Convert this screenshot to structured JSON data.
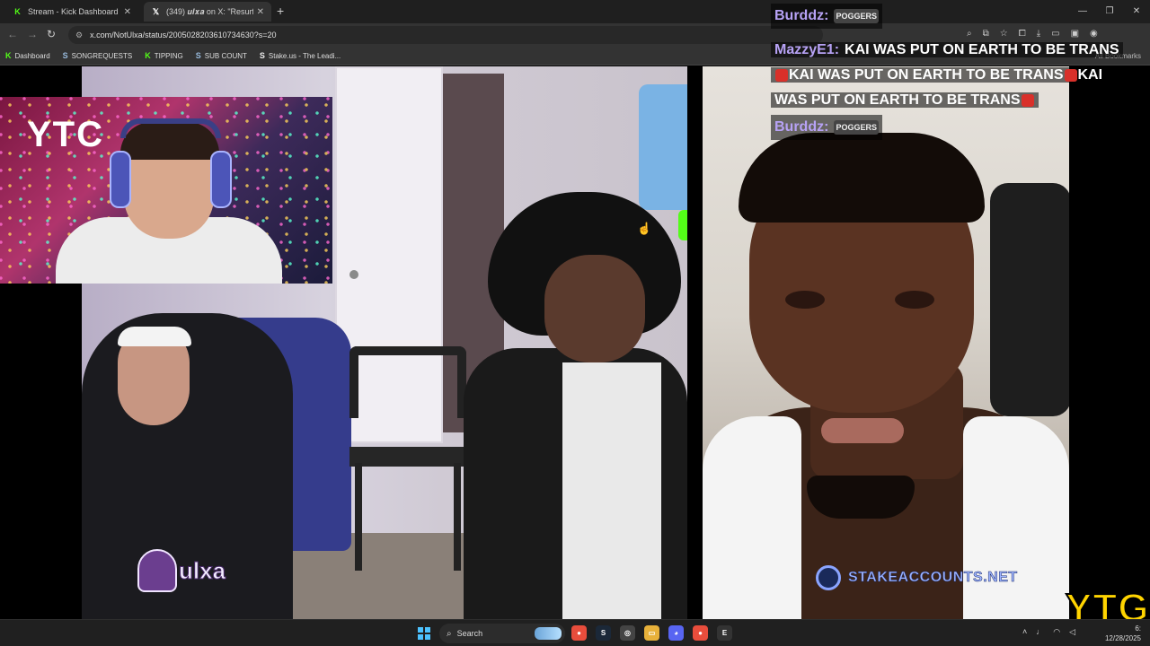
{
  "browser": {
    "tabs": [
      {
        "title": "Stream - Kick Dashboard",
        "favicon": "kick-icon"
      },
      {
        "title": "(349) 𝒖𝒍𝒙𝒂 on X: \"Resurfa",
        "favicon": "x-icon"
      }
    ],
    "url": "x.com/NotUlxa/status/2005028203610734630?s=20",
    "bookmarks": [
      {
        "label": "Dashboard",
        "icon": "kick-icon"
      },
      {
        "label": "SONGREQUESTS",
        "icon": "streamelements-icon"
      },
      {
        "label": "TIPPING",
        "icon": "kick-icon"
      },
      {
        "label": "SUB COUNT",
        "icon": "streamelements-icon"
      },
      {
        "label": "Stake.us - The Leadi...",
        "icon": "stake-icon"
      }
    ],
    "all_bookmarks": "All Bookmarks"
  },
  "stream": {
    "webcam_sign": "YTC",
    "ulxa_name": "ulxa",
    "stake_banner": "STAKEACCOUNTS.NET",
    "ytg_logo": "YTG"
  },
  "chat": [
    {
      "user": "Burddz:",
      "emote": "POGGERS"
    },
    {
      "user": "MazzyE1:",
      "text_1": "KAI WAS PUT ON EARTH TO BE TRANS",
      "text_2": "KAI WAS PUT ON EARTH TO BE TRANS",
      "text_3": "KAI WAS PUT ON EARTH TO BE TRANS"
    },
    {
      "user": "Burddz:",
      "emote": "POGGERS"
    }
  ],
  "taskbar": {
    "search_label": "Search",
    "date": "12/28/2025",
    "time": "6:"
  },
  "colors": {
    "kick_green": "#53fc18",
    "chat_user": "#b7a2f5",
    "ytg_yellow": "#ffd400"
  }
}
